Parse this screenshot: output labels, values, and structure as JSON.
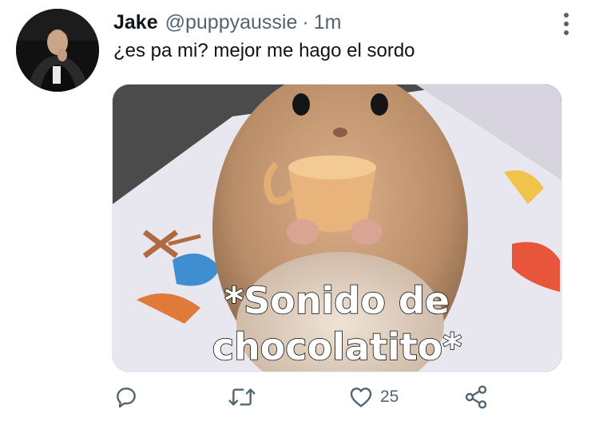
{
  "tweet": {
    "name": "Jake",
    "handle": "@puppyaussie",
    "separator": "·",
    "time": "1m",
    "text": "¿es pa mi? mejor me hago el sordo",
    "media": {
      "caption_line1": "*Sonido de",
      "caption_line2": "chocolatito*"
    }
  },
  "actions": {
    "reply_icon": "reply-icon",
    "retweet_icon": "retweet-icon",
    "like_icon": "heart-icon",
    "like_count": "25",
    "share_icon": "share-icon"
  },
  "colors": {
    "text": "#0f1419",
    "secondary": "#536471"
  }
}
